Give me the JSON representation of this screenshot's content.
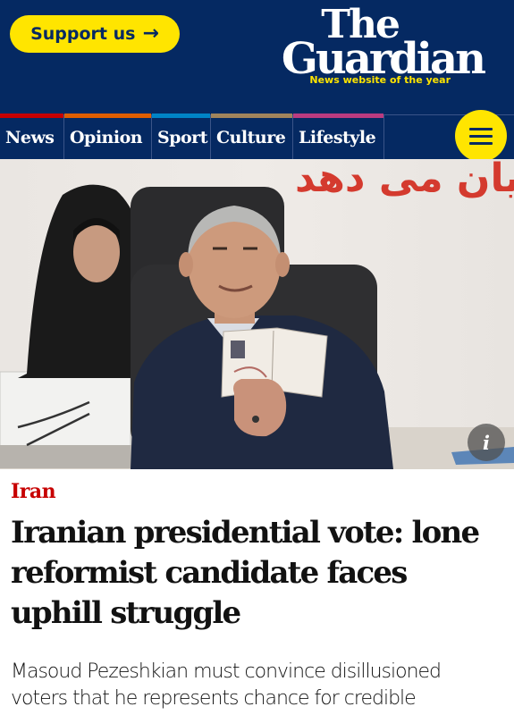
{
  "header": {
    "support_label": "Support us",
    "support_arrow": "→",
    "logo_line1": "The",
    "logo_line2": "Guardian",
    "tagline": "News website of the year",
    "brand_color": "#052962",
    "accent_color": "#ffe500"
  },
  "nav": {
    "items": [
      {
        "label": "News",
        "pillar_color": "#c70000"
      },
      {
        "label": "Opinion",
        "pillar_color": "#e05e00"
      },
      {
        "label": "Sport",
        "pillar_color": "#0084c6"
      },
      {
        "label": "Culture",
        "pillar_color": "#a1845c"
      },
      {
        "label": "Lifestyle",
        "pillar_color": "#bb3b80"
      }
    ],
    "menu_icon": "hamburger-icon"
  },
  "photo": {
    "info_label": "i",
    "background_slogan": "هایان می دهد"
  },
  "article": {
    "kicker": "Iran",
    "kicker_color": "#c70000",
    "headline_lines": [
      "Iranian presidential vote: lone",
      "reformist candidate faces",
      "uphill struggle"
    ],
    "standfirst_lines": [
      "Masoud Pezeshkian must convince disillusioned",
      "voters that he represents chance for credible"
    ]
  }
}
